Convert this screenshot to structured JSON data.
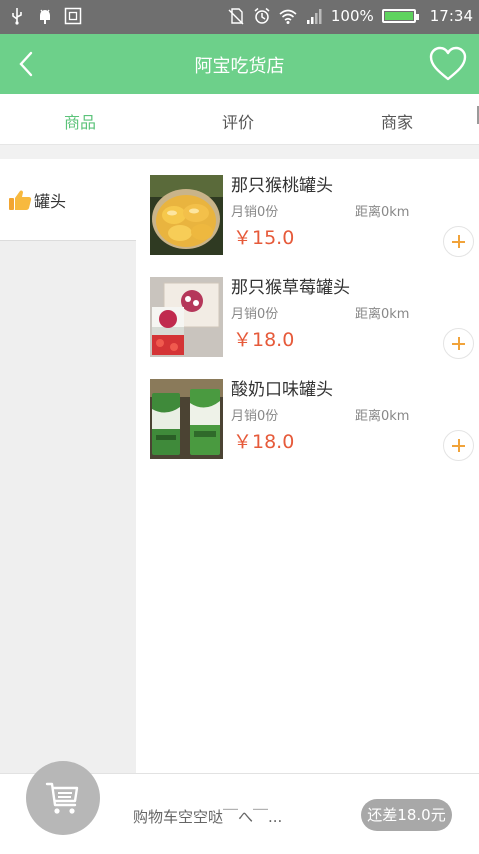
{
  "status_bar": {
    "battery_text": "100%",
    "time": "17:34",
    "battery_level": 1.0,
    "icons": [
      "usb-icon",
      "android-debug-icon",
      "screenshot-icon",
      "no-sim-icon",
      "alarm-icon",
      "wifi-icon",
      "signal-icon",
      "battery-icon"
    ]
  },
  "header": {
    "title": "阿宝吃货店",
    "back_icon": "back-chevron-icon",
    "favorite_icon": "heart-outline-icon",
    "color": "#6dd08a"
  },
  "tabs": [
    {
      "label": "商品",
      "active": true
    },
    {
      "label": "评价",
      "active": false
    },
    {
      "label": "商家",
      "active": false
    }
  ],
  "sidebar": {
    "categories": [
      {
        "label": "罐头",
        "icon": "thumbs-up-icon",
        "selected": true
      }
    ]
  },
  "products": [
    {
      "name": "那只猴桃罐头",
      "sales": "月销0份",
      "distance": "距离0km",
      "price": "￥15.0"
    },
    {
      "name": "那只猴草莓罐头",
      "sales": "月销0份",
      "distance": "距离0km",
      "price": "￥18.0"
    },
    {
      "name": "酸奶口味罐头",
      "sales": "月销0份",
      "distance": "距离0km",
      "price": "￥18.0"
    }
  ],
  "cart": {
    "empty_text": "购物车空空哒￣へ￣...",
    "remaining_text": "还差18.0元",
    "icon": "shopping-cart-icon"
  },
  "colors": {
    "accent": "#6dd08a",
    "tab_active": "#5cc37a",
    "price": "#e65a3a",
    "add_button": "#f1a33a"
  }
}
